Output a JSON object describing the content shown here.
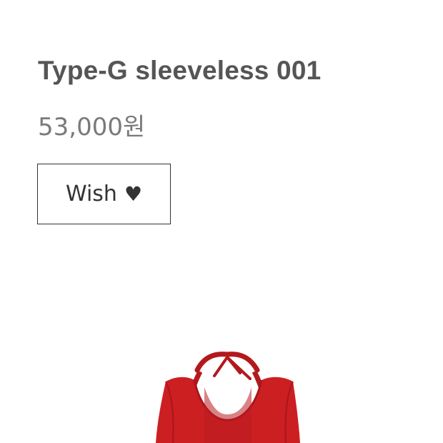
{
  "product": {
    "title": "Type-G sleeveless 001",
    "price": "53,000원",
    "wish_label": "Wish",
    "wish_icon": "♥",
    "image": {
      "icon": "red-sleeveless-top",
      "garment_color": "#cc1f22"
    }
  }
}
